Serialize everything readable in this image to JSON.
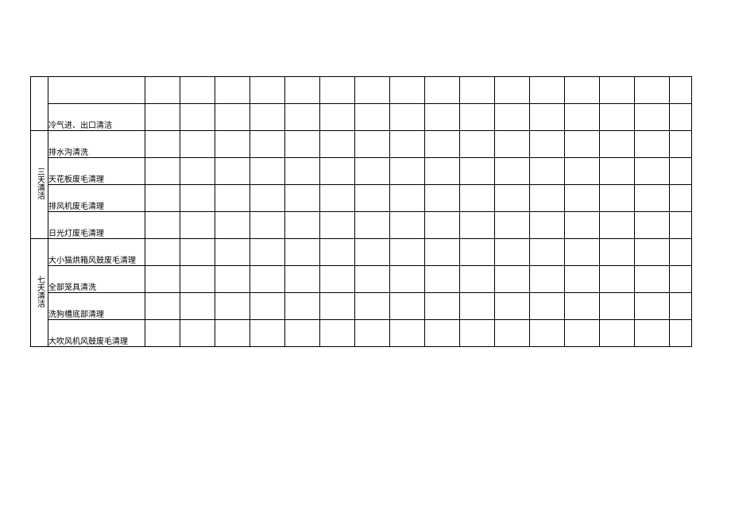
{
  "sections": [
    {
      "category": "",
      "tasks": [
        "",
        "冷气进、出口清洁"
      ]
    },
    {
      "category": "三天清洁",
      "tasks": [
        "排水沟清洗",
        "天花板废毛清理",
        "排风机废毛清理",
        "日光灯废毛清理"
      ]
    },
    {
      "category": "七天清洁",
      "tasks": [
        "大小猫烘箱风鼓废毛清理",
        "全部笼具清洗",
        "洗狗槽底部清理",
        "大吹风机风鼓废毛清理"
      ]
    }
  ],
  "check_columns": 16
}
